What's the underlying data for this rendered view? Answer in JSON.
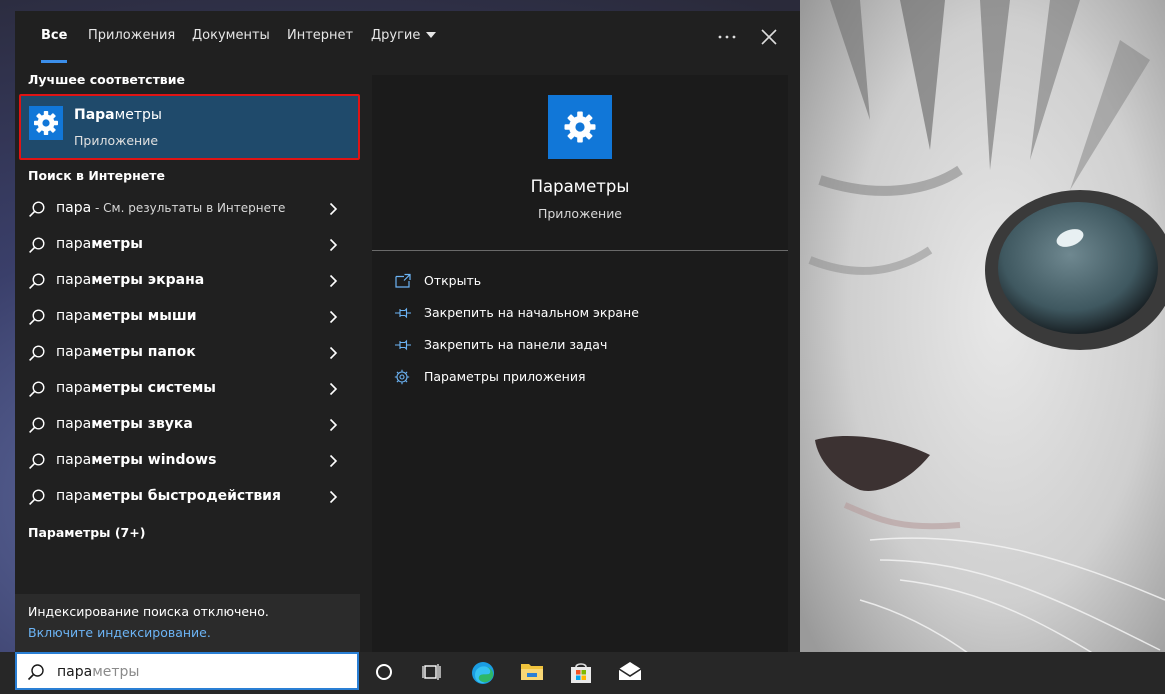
{
  "tabs": [
    {
      "label": "Все",
      "active": true
    },
    {
      "label": "Приложения"
    },
    {
      "label": "Документы"
    },
    {
      "label": "Интернет"
    },
    {
      "label": "Другие"
    }
  ],
  "toolbar": {
    "more_icon": "ellipsis-icon",
    "close_icon": "close-icon"
  },
  "best_match": {
    "header": "Лучшее соответствие",
    "title_bold": "Пара",
    "title_rest": "метры",
    "subtitle": "Приложение",
    "icon": "gear-icon"
  },
  "web_search": {
    "header": "Поиск в Интернете",
    "items": [
      {
        "query": "пара",
        "suffix": "",
        "hint": " - См. результаты в Интернете"
      },
      {
        "query": "пара",
        "suffix": "метры",
        "hint": ""
      },
      {
        "query": "пара",
        "suffix": "метры экрана",
        "hint": ""
      },
      {
        "query": "пара",
        "suffix": "метры мыши",
        "hint": ""
      },
      {
        "query": "пара",
        "suffix": "метры папок",
        "hint": ""
      },
      {
        "query": "пара",
        "suffix": "метры системы",
        "hint": ""
      },
      {
        "query": "пара",
        "suffix": "метры звука",
        "hint": ""
      },
      {
        "query": "пара",
        "suffix": "метры windows",
        "hint": ""
      },
      {
        "query": "пара",
        "suffix": "метры быстродействия",
        "hint": ""
      }
    ]
  },
  "settings_section": {
    "header": "Параметры (7+)"
  },
  "footer": {
    "info": "Индексирование поиска отключено.",
    "link": "Включите индексирование."
  },
  "preview": {
    "title": "Параметры",
    "subtitle": "Приложение",
    "actions": [
      {
        "label": "Открыть",
        "icon": "open-window-icon"
      },
      {
        "label": "Закрепить на начальном экране",
        "icon": "pin-icon"
      },
      {
        "label": "Закрепить на панели задач",
        "icon": "pin-icon"
      },
      {
        "label": "Параметры приложения",
        "icon": "gear-icon"
      }
    ]
  },
  "search_box": {
    "typed": "пара",
    "autocomplete": "метры"
  },
  "taskbar": {
    "buttons": [
      "cortana-circle-icon",
      "task-view-icon",
      "edge-icon",
      "file-explorer-icon",
      "store-icon",
      "mail-icon"
    ]
  },
  "colors": {
    "accent": "#1177d8",
    "highlight_border": "#e01414",
    "selected_bg": "#1f4a6b",
    "link": "#6cb4f5"
  }
}
